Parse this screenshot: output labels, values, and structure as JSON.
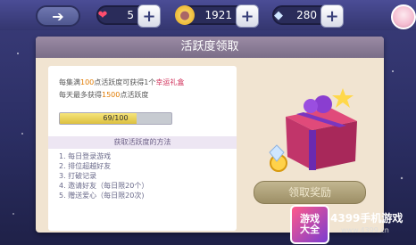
{
  "topbar": {
    "hearts": "5",
    "coins": "1921",
    "diamonds": "280"
  },
  "panel": {
    "title": "活跃度领取",
    "desc_prefix": "每集满",
    "desc_points": "100",
    "desc_mid": "点活跃度可获得1个",
    "desc_reward": "幸运礼盒",
    "daily_prefix": "每天最多获得",
    "daily_points": "1500",
    "daily_suffix": "点活跃度",
    "progress_text": "69/100",
    "progress_value": 0.69,
    "methods_title": "获取活跃度的方法",
    "methods": [
      "1. 每日登录游戏",
      "2. 排位超越好友",
      "3. 打破记录",
      "4. 邀请好友（每日限20个）",
      "5. 赠送爱心（每日限20次)"
    ],
    "claim_button": "领取奖励"
  },
  "watermark": {
    "logo_line1": "游戏",
    "logo_line2": "大全",
    "brand": "4399手机游戏",
    "url": "www.4399.cn"
  },
  "colors": {
    "accent": "#e07a00",
    "reward": "#d0305a"
  }
}
